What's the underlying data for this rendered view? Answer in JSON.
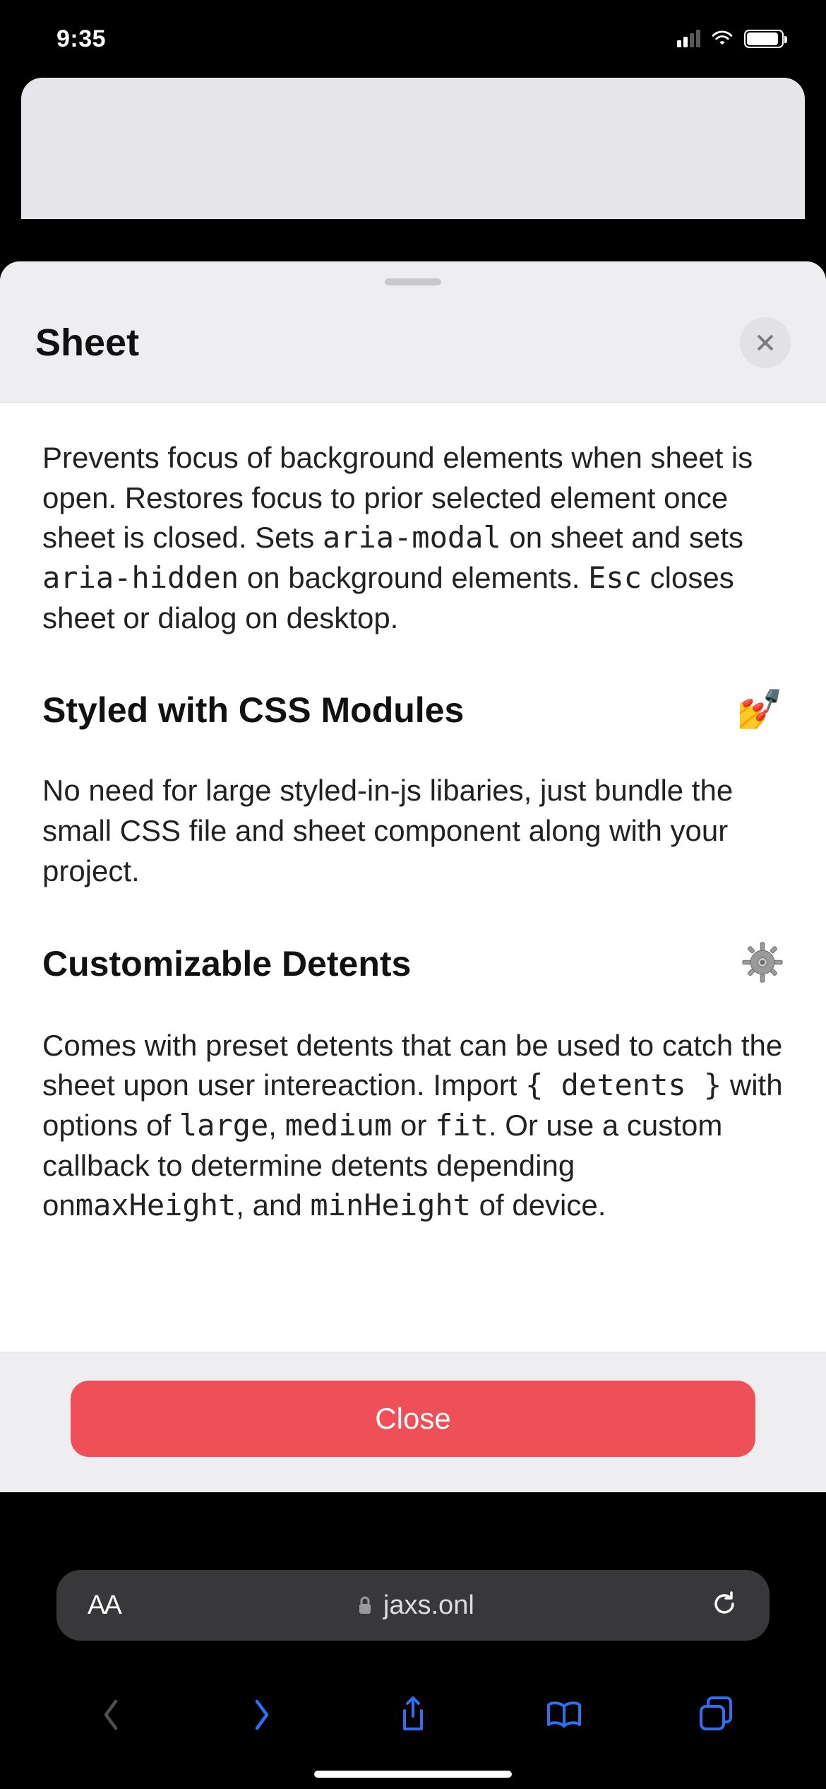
{
  "status": {
    "time": "9:35"
  },
  "sheet": {
    "title": "Sheet",
    "close_label": "Close",
    "sections": {
      "intro_html": "Prevents focus of background elements when sheet is open. Restores focus to prior selected element once sheet is closed. Sets <span class=\"inline-code\">aria-modal</span> on sheet and sets <span class=\"inline-code\">aria-hidden</span> on background elements. <span class=\"inline-code\">Esc</span> closes sheet or dialog on desktop.",
      "css_heading": "Styled with CSS Modules",
      "css_emoji": "💅",
      "css_body": "No need for large styled-in-js libaries, just bundle the small CSS file and sheet component along with your project.",
      "detents_heading": "Customizable Detents",
      "detents_body_html": "Comes with preset detents that can be used to catch the sheet upon user intereaction. Import <span class=\"inline-code\">{ detents }</span> with options of <span class=\"inline-code\">large</span>, <span class=\"inline-code\">medium</span> or <span class=\"inline-code\">fit</span>. Or use a custom callback to determine detents depending on<span class=\"inline-code\">maxHeight</span>, and <span class=\"inline-code\">minHeight</span> of device."
    }
  },
  "browser": {
    "url_display": "jaxs.onl",
    "aa_label": "AA"
  }
}
